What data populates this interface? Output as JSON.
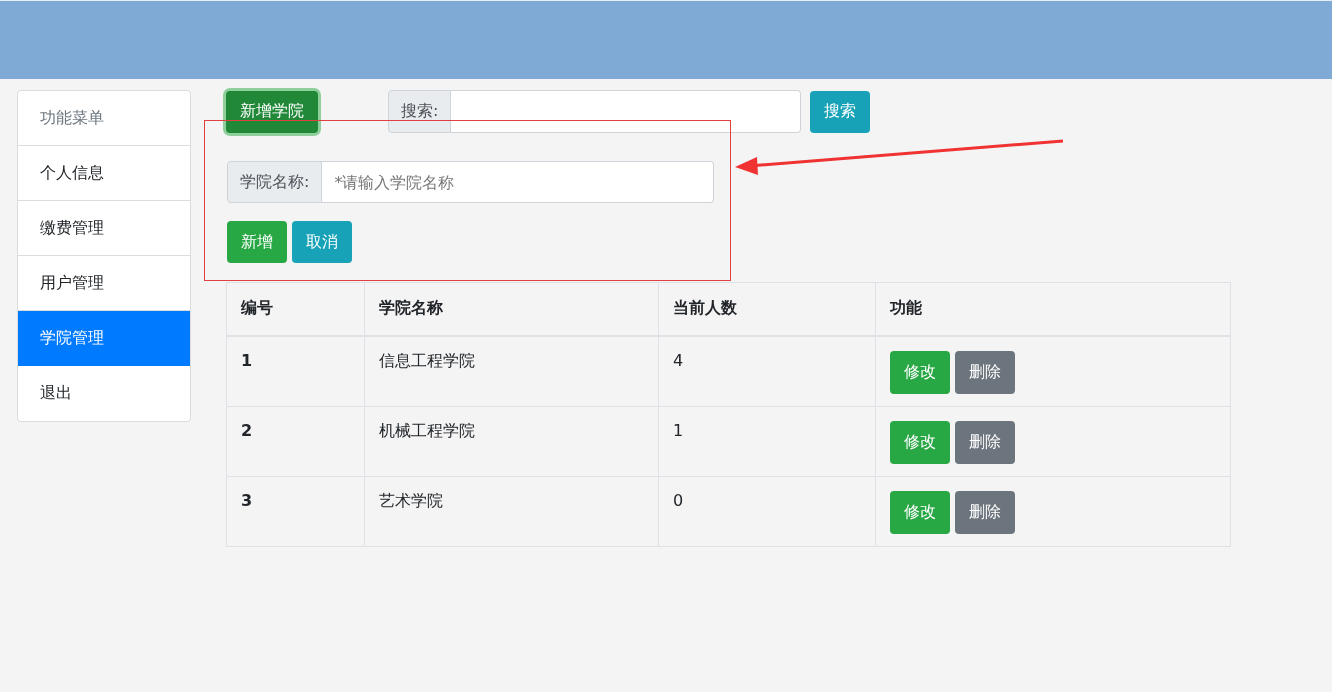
{
  "sidebar": {
    "title": "功能菜单",
    "items": [
      {
        "label": "个人信息",
        "selected": false
      },
      {
        "label": "缴费管理",
        "selected": false
      },
      {
        "label": "用户管理",
        "selected": false
      },
      {
        "label": "学院管理",
        "selected": true
      },
      {
        "label": "退出",
        "selected": false
      }
    ]
  },
  "toolbar": {
    "add_button": "新增学院",
    "search_label": "搜索:",
    "search_button": "搜索"
  },
  "add_form": {
    "label": "学院名称:",
    "placeholder": "*请输入学院名称",
    "submit": "新增",
    "cancel": "取消"
  },
  "table": {
    "columns": [
      "编号",
      "学院名称",
      "当前人数",
      "功能"
    ],
    "rows": [
      {
        "id": "1",
        "name": "信息工程学院",
        "count": "4",
        "edit": "修改",
        "delete": "删除"
      },
      {
        "id": "2",
        "name": "机械工程学院",
        "count": "1",
        "edit": "修改",
        "delete": "删除"
      },
      {
        "id": "3",
        "name": "艺术学院",
        "count": "0",
        "edit": "修改",
        "delete": "删除"
      }
    ]
  }
}
